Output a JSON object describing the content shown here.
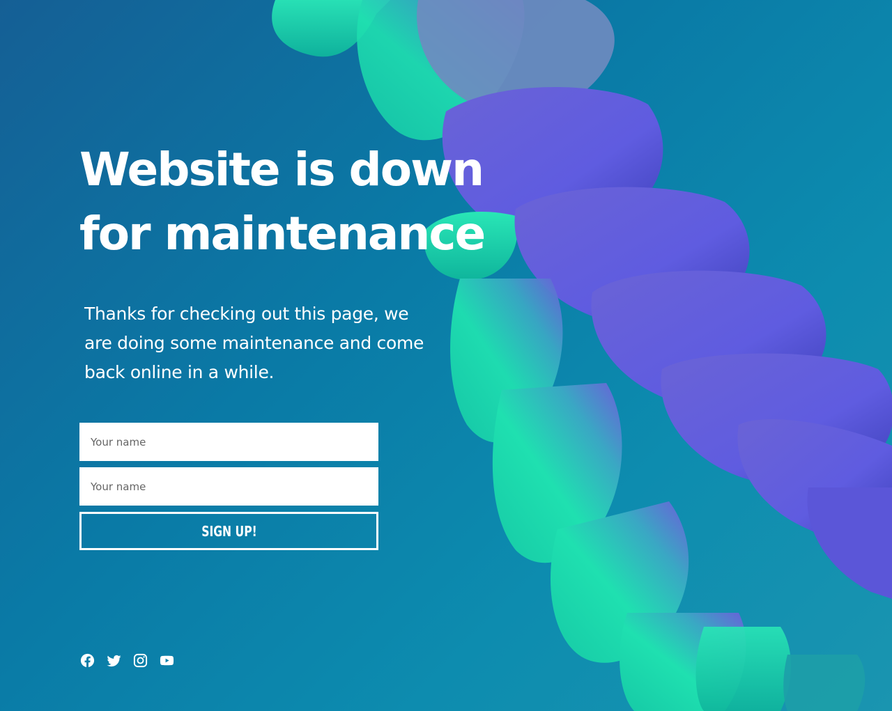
{
  "page": {
    "title": "Website is down for maintenance",
    "title_line_1": "Website is down",
    "title_line_2": "for maintenance",
    "subtitle": "Thanks for checking out this page, we are doing some maintenance and come back online in a while."
  },
  "form": {
    "name_placeholder": "Your name",
    "second_placeholder": "Your name",
    "submit_label": "SIGN UP!"
  },
  "socials": [
    {
      "icon": "facebook-icon"
    },
    {
      "icon": "twitter-icon"
    },
    {
      "icon": "instagram-icon"
    },
    {
      "icon": "youtube-icon"
    }
  ],
  "colors": {
    "background": "#0a7aa6",
    "text": "#ffffff",
    "accent_green": "#17d3a8",
    "accent_purple": "#6a5ad8"
  }
}
